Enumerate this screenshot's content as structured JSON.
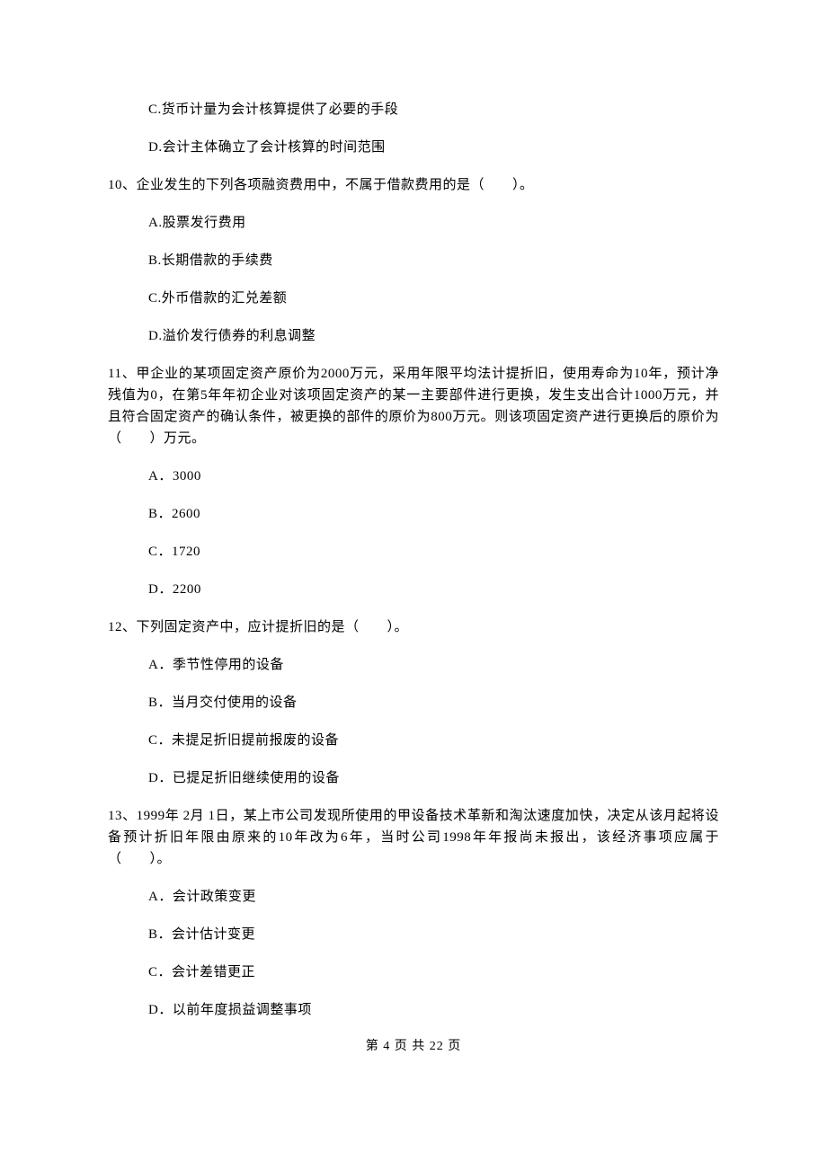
{
  "q9_optC": "C.货币计量为会计核算提供了必要的手段",
  "q9_optD": "D.会计主体确立了会计核算的时间范围",
  "q10_stem": "10、企业发生的下列各项融资费用中，不属于借款费用的是（　　）。",
  "q10_optA": "A.股票发行费用",
  "q10_optB": "B.长期借款的手续费",
  "q10_optC": "C.外币借款的汇兑差额",
  "q10_optD": "D.溢价发行债券的利息调整",
  "q11_stem": "11、甲企业的某项固定资产原价为2000万元，采用年限平均法计提折旧，使用寿命为10年，预计净残值为0，在第5年年初企业对该项固定资产的某一主要部件进行更换，发生支出合计1000万元，并且符合固定资产的确认条件，被更换的部件的原价为800万元。则该项固定资产进行更换后的原价为（　　）万元。",
  "q11_optA": "A．3000",
  "q11_optB": "B．2600",
  "q11_optC": "C．1720",
  "q11_optD": "D．2200",
  "q12_stem": "12、下列固定资产中，应计提折旧的是（　　）。",
  "q12_optA": "A．季节性停用的设备",
  "q12_optB": "B．当月交付使用的设备",
  "q12_optC": "C．未提足折旧提前报废的设备",
  "q12_optD": "D．已提足折旧继续使用的设备",
  "q13_stem": "13、1999年 2月 1日，某上市公司发现所使用的甲设备技术革新和淘汰速度加快，决定从该月起将设备预计折旧年限由原来的10年改为6年，当时公司1998年年报尚未报出，该经济事项应属于（　　）。",
  "q13_optA": "A．会计政策变更",
  "q13_optB": "B．会计估计变更",
  "q13_optC": "C．会计差错更正",
  "q13_optD": "D．以前年度损益调整事项",
  "footer": "第 4 页 共 22 页"
}
